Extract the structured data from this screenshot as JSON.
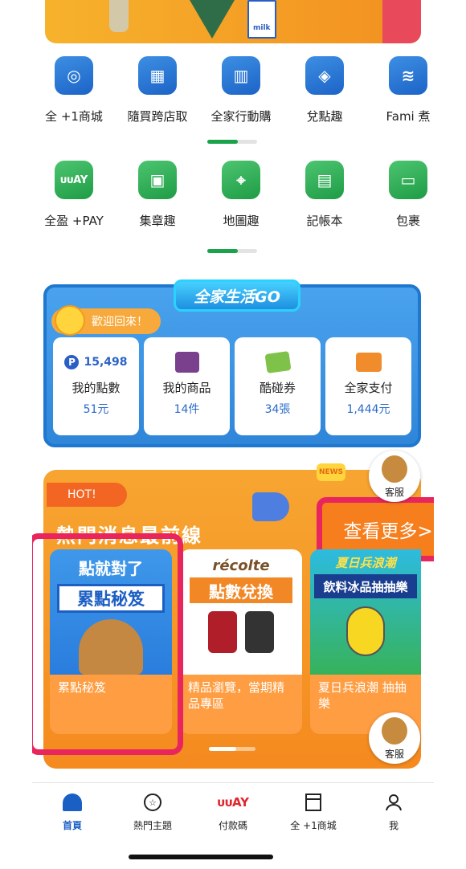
{
  "banner": {
    "milk_label": "milk"
  },
  "row1": [
    {
      "label": "全 +1商城",
      "icon": "shopping-bags-icon"
    },
    {
      "label": "隨買跨店取",
      "icon": "cart-store-icon"
    },
    {
      "label": "全家行動購",
      "icon": "store-barcode-icon"
    },
    {
      "label": "兌點趣",
      "icon": "gift-box-icon"
    },
    {
      "label": "Fami 煮",
      "icon": "steam-icon"
    }
  ],
  "row2": [
    {
      "label": "全盈 +PAY",
      "icon": "pay-logo-icon",
      "glyph": "ᴜᴜAY"
    },
    {
      "label": "集章趣",
      "icon": "stamp-grid-icon"
    },
    {
      "label": "地圖趣",
      "icon": "map-pin-icon"
    },
    {
      "label": "記帳本",
      "icon": "notebook-icon"
    },
    {
      "label": "包裹",
      "icon": "package-icon"
    }
  ],
  "go": {
    "title": "全家生活GO",
    "welcome": "歡迎回來！",
    "tiles": [
      {
        "top": "15,498",
        "label": "我的點數",
        "value": "51元"
      },
      {
        "label": "我的商品",
        "value": "14件"
      },
      {
        "label": "酷碰券",
        "value": "34張"
      },
      {
        "label": "全家支付",
        "value": "1,444元"
      }
    ]
  },
  "hot": {
    "tag": "HOT!",
    "title": "熱門消息最前線",
    "more": "查看更多>",
    "support": "客服",
    "news": "NEWS",
    "cards": [
      {
        "line1": "點就對了",
        "line2": "累點秘笈",
        "caption": "累點秘笈"
      },
      {
        "line1": "récolte",
        "line2": "點數兌換",
        "caption": "精品瀏覽，當期精品專區"
      },
      {
        "line1": "夏日兵浪潮",
        "line2": "飲料冰品抽抽樂",
        "caption": "夏日兵浪潮 抽抽樂"
      }
    ]
  },
  "nav": [
    {
      "label": "首頁",
      "icon": "home-icon"
    },
    {
      "label": "熱門主題",
      "icon": "star-bubble-icon"
    },
    {
      "label": "付款碼",
      "icon": "pay-logo-icon",
      "glyph": "ᴜᴜAY"
    },
    {
      "label": "全 +1商城",
      "icon": "store-app-icon"
    },
    {
      "label": "我",
      "icon": "person-icon"
    }
  ]
}
